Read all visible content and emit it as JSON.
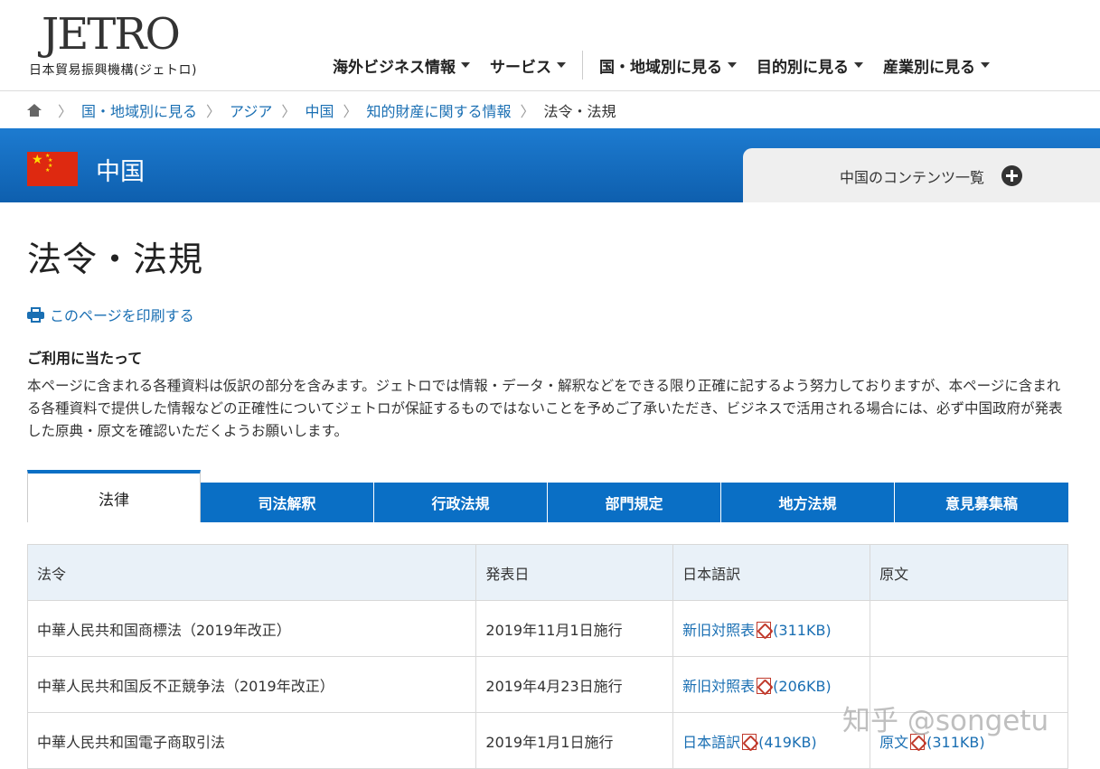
{
  "header": {
    "logo_text": "JETRO",
    "logo_sub": "日本貿易振興機構(ジェトロ)",
    "nav": [
      {
        "label": "海外ビジネス情報"
      },
      {
        "label": "サービス"
      },
      {
        "label": "国・地域別に見る"
      },
      {
        "label": "目的別に見る"
      },
      {
        "label": "産業別に見る"
      }
    ]
  },
  "breadcrumb": {
    "items": [
      "国・地域別に見る",
      "アジア",
      "中国",
      "知的財産に関する情報"
    ],
    "current": "法令・法規"
  },
  "banner": {
    "country": "中国",
    "contents_label": "中国のコンテンツ一覧",
    "flag_colors": {
      "red": "#de2910",
      "yellow": "#ffde00"
    }
  },
  "main": {
    "title": "法令・法規",
    "print_label": "このページを印刷する",
    "notice_heading": "ご利用に当たって",
    "notice_text": "本ページに含まれる各種資料は仮訳の部分を含みます。ジェトロでは情報・データ・解釈などをできる限り正確に記するよう努力しておりますが、本ページに含まれる各種資料で提供した情報などの正確性についてジェトロが保証するものではないことを予めご了承いただき、ビジネスで活用される場合には、必ず中国政府が発表した原典・原文を確認いただくようお願いします。"
  },
  "tabs": [
    {
      "label": "法律",
      "active": true
    },
    {
      "label": "司法解釈"
    },
    {
      "label": "行政法規"
    },
    {
      "label": "部門規定"
    },
    {
      "label": "地方法規"
    },
    {
      "label": "意見募集稿"
    }
  ],
  "table": {
    "headers": [
      "法令",
      "発表日",
      "日本語訳",
      "原文"
    ],
    "rows": [
      {
        "law": "中華人民共和国商標法（2019年改正）",
        "date": "2019年11月1日施行",
        "ja_label": "新旧対照表",
        "ja_size": "(311KB)",
        "orig_label": "",
        "orig_size": ""
      },
      {
        "law": "中華人民共和国反不正競争法（2019年改正）",
        "date": "2019年4月23日施行",
        "ja_label": "新旧対照表",
        "ja_size": "(206KB)",
        "orig_label": "",
        "orig_size": ""
      },
      {
        "law": "中華人民共和国電子商取引法",
        "date": "2019年1月1日施行",
        "ja_label": "日本語訳",
        "ja_size": "(419KB)",
        "orig_label": "原文",
        "orig_size": "(311KB)"
      }
    ]
  },
  "watermark": "知乎 @songetu",
  "colors": {
    "primary_blue": "#0a6fc5",
    "link": "#1a6fb3",
    "th_bg": "#e9f1f8"
  }
}
